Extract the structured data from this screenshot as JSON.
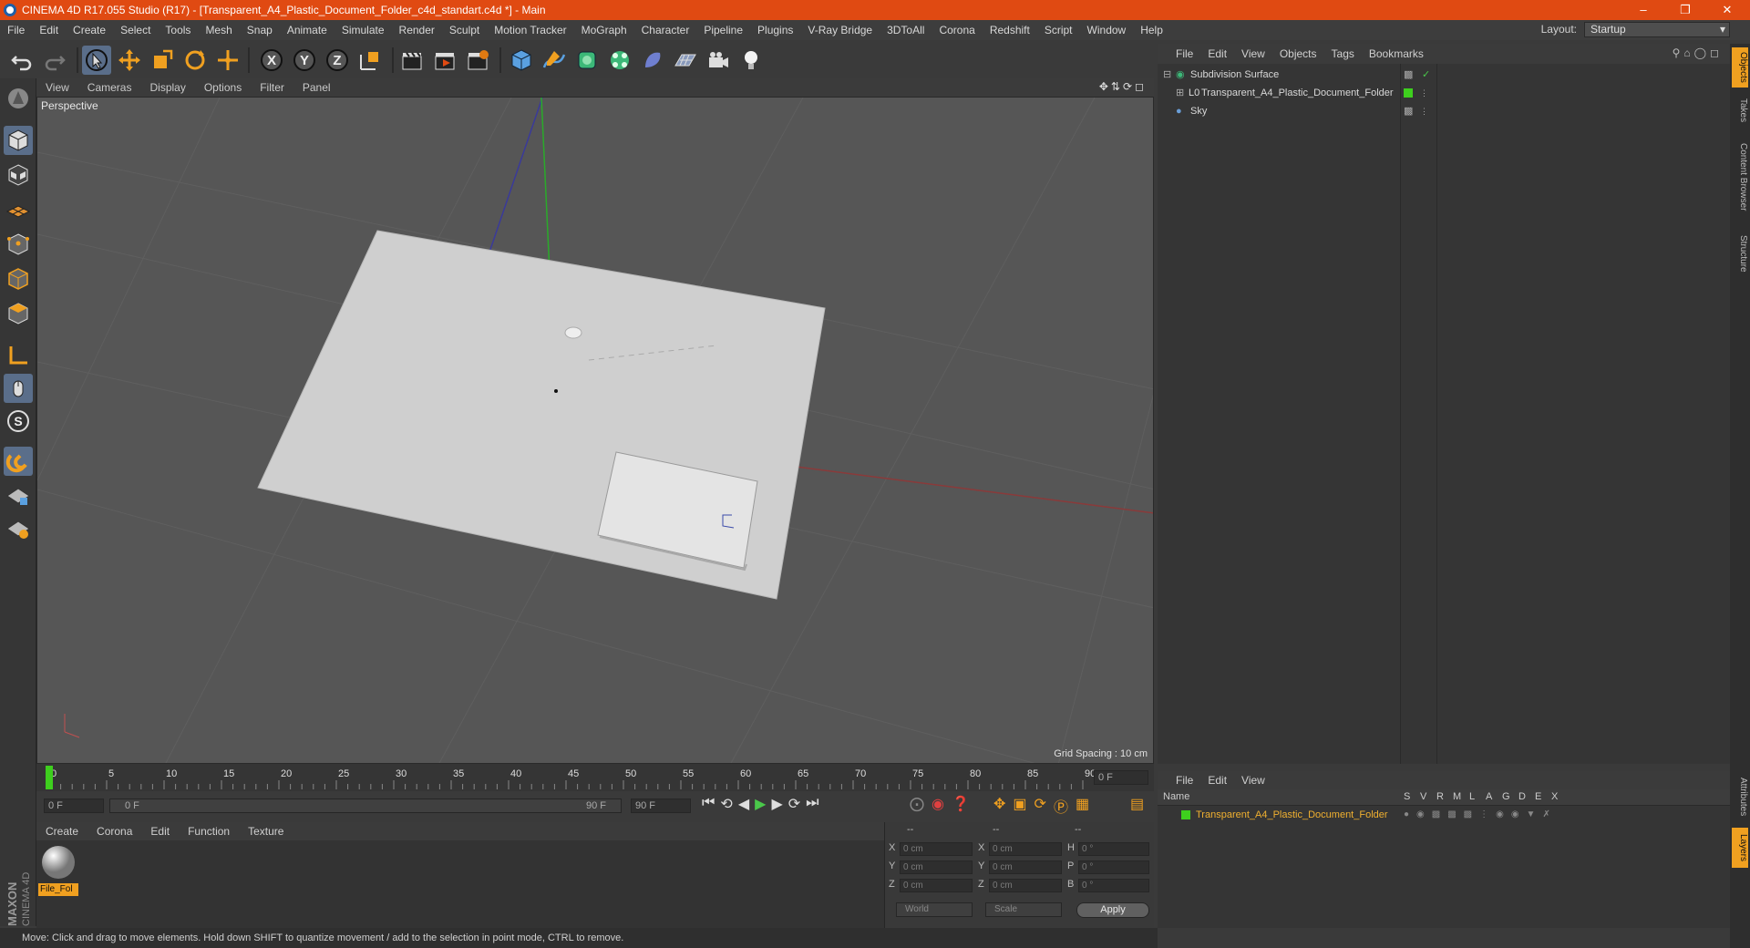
{
  "window": {
    "title": "CINEMA 4D R17.055 Studio (R17) - [Transparent_A4_Plastic_Document_Folder_c4d_standart.c4d *] - Main"
  },
  "menubar": {
    "items": [
      "File",
      "Edit",
      "Create",
      "Select",
      "Tools",
      "Mesh",
      "Snap",
      "Animate",
      "Simulate",
      "Render",
      "Sculpt",
      "Motion Tracker",
      "MoGraph",
      "Character",
      "Pipeline",
      "Plugins",
      "V-Ray Bridge",
      "3DToAll",
      "Corona",
      "Redshift",
      "Script",
      "Window",
      "Help"
    ],
    "layout_label": "Layout:",
    "layout_value": "Startup"
  },
  "viewport": {
    "menu": [
      "View",
      "Cameras",
      "Display",
      "Options",
      "Filter",
      "Panel"
    ],
    "label": "Perspective",
    "grid_spacing": "Grid Spacing : 10 cm"
  },
  "timeline": {
    "ticks": [
      "0",
      "5",
      "10",
      "15",
      "20",
      "25",
      "30",
      "35",
      "40",
      "45",
      "50",
      "55",
      "60",
      "65",
      "70",
      "75",
      "80",
      "85",
      "90"
    ],
    "current_frame": "0 F",
    "start_frame": "0 F",
    "range_start": "0 F",
    "range_end": "90 F",
    "end_frame": "90 F"
  },
  "material_manager": {
    "menu": [
      "Create",
      "Corona",
      "Edit",
      "Function",
      "Texture"
    ],
    "material_name": "File_Fol"
  },
  "coords": {
    "header": [
      "--",
      "--",
      "--"
    ],
    "pos_labels": [
      "X",
      "Y",
      "Z"
    ],
    "pos_values": [
      "0 cm",
      "0 cm",
      "0 cm"
    ],
    "size_labels": [
      "X",
      "Y",
      "Z"
    ],
    "size_values": [
      "0 cm",
      "0 cm",
      "0 cm"
    ],
    "rot_labels": [
      "H",
      "P",
      "B"
    ],
    "rot_values": [
      "0 °",
      "0 °",
      "0 °"
    ],
    "mode_world": "World",
    "mode_scale": "Scale",
    "apply": "Apply"
  },
  "status": {
    "text": "Move: Click and drag to move elements. Hold down SHIFT to quantize movement / add to the selection in point mode, CTRL to remove."
  },
  "object_manager": {
    "menu": [
      "File",
      "Edit",
      "View",
      "Objects",
      "Tags",
      "Bookmarks"
    ],
    "objects": [
      {
        "name": "Subdivision Surface"
      },
      {
        "name": "Transparent_A4_Plastic_Document_Folder"
      },
      {
        "name": "Sky"
      }
    ]
  },
  "layer_manager": {
    "menu": [
      "File",
      "Edit",
      "View"
    ],
    "columns": [
      "Name",
      "S",
      "V",
      "R",
      "M",
      "L",
      "A",
      "G",
      "D",
      "E",
      "X"
    ],
    "layer_name": "Transparent_A4_Plastic_Document_Folder",
    "layer_color": "#3ecf1e"
  },
  "right_tabs": [
    "Objects",
    "Takes",
    "Content Browser",
    "Structure",
    "Attributes",
    "Layers"
  ],
  "brand": {
    "maxon": "MAXON",
    "c4d": "CINEMA 4D"
  },
  "colors": {
    "titlebar": "#e04a12",
    "accent": "#f0a020",
    "selected_text": "#f0b030"
  }
}
